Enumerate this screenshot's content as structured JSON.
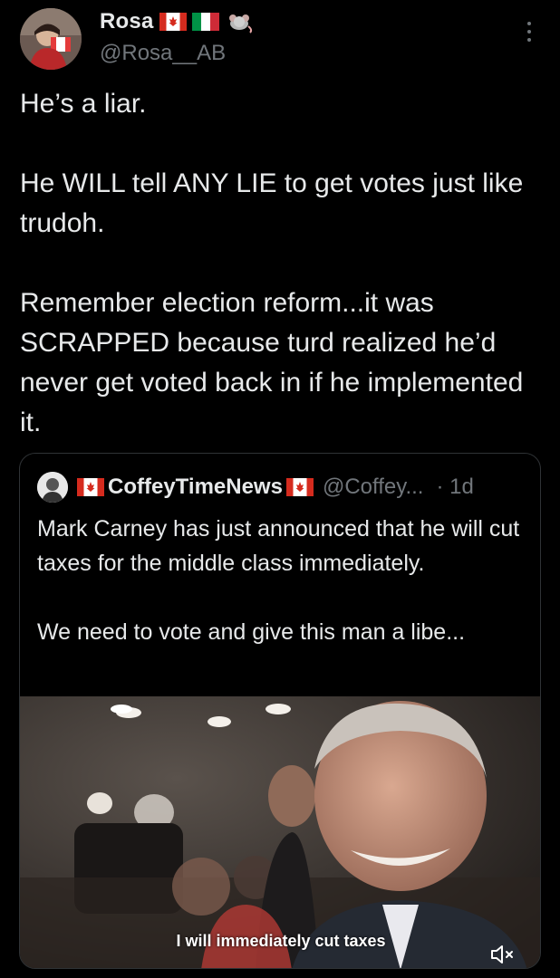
{
  "post": {
    "author": {
      "display_name": "Rosa",
      "handle": "@Rosa__AB",
      "emoji_icons": [
        "canada-flag-icon",
        "italy-flag-icon",
        "rat-icon"
      ]
    },
    "text": "He’s a liar.\n\nHe WILL tell ANY LIE to get votes just like trudoh.\n\nRemember election reform...it was SCRAPPED because turd realized he’d never get voted back in if he implemented it."
  },
  "quote": {
    "author": {
      "display_name": "CoffeyTimeNews",
      "handle": "@Coffey...",
      "time": "· 1d"
    },
    "text": "Mark Carney has just announced that he will cut taxes for the middle class immediately.\n\nWe need to vote and give this man a libe...",
    "video": {
      "caption": "I will immediately cut taxes",
      "muted": true
    }
  },
  "colors": {
    "background": "#000000",
    "text": "#e7e9ea",
    "secondary": "#71767b",
    "border": "#2f3336"
  }
}
